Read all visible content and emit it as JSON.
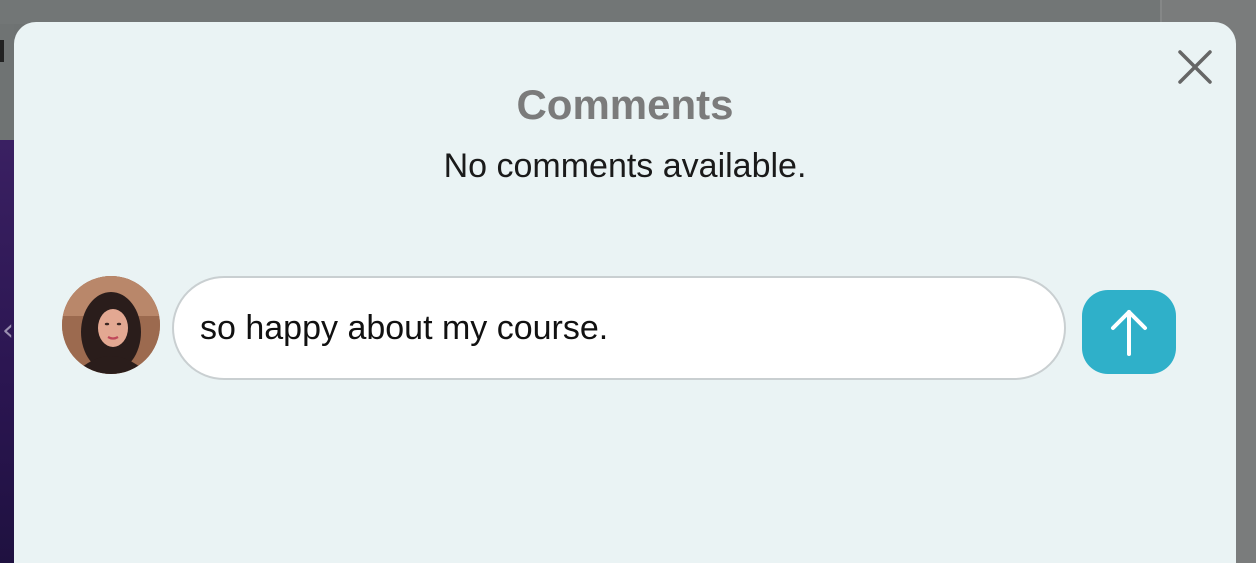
{
  "modal": {
    "title": "Comments",
    "empty_message": "No comments available.",
    "close_icon": "close-icon"
  },
  "composer": {
    "avatar_icon": "user-avatar",
    "input_value": "so happy about my course.",
    "send_icon": "arrow-up-icon"
  },
  "colors": {
    "modal_background": "#eaf3f4",
    "send_button": "#2fb0c9",
    "title_text": "#7b7b7b"
  }
}
